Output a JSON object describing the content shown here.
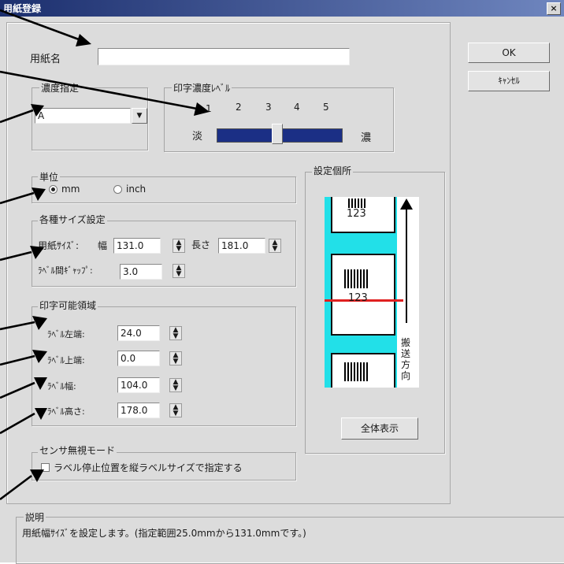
{
  "window": {
    "title": "用紙登録",
    "close": "×"
  },
  "paper_name": {
    "label": "用紙名",
    "value": ""
  },
  "density": {
    "group_label": "濃度指定",
    "value": "A"
  },
  "print_level": {
    "group_label": "印字濃度ﾚﾍﾞﾙ",
    "ticks": [
      "1",
      "2",
      "3",
      "4",
      "5"
    ],
    "low_label": "淡",
    "high_label": "濃",
    "level": 3
  },
  "unit": {
    "group_label": "単位",
    "options": [
      "mm",
      "inch"
    ],
    "selected": "mm"
  },
  "size": {
    "group_label": "各種サイズ設定",
    "paper_size_label": "用紙ｻｲｽﾞ:",
    "width_label": "幅",
    "width_value": "131.0",
    "length_label": "長さ",
    "length_value": "181.0",
    "gap_label": "ﾗﾍﾞﾙ間ｷﾞｬｯﾌﾟ:",
    "gap_value": "3.0"
  },
  "print_area": {
    "group_label": "印字可能領域",
    "rows": [
      {
        "label": "ﾗﾍﾞﾙ左端:",
        "value": "24.0"
      },
      {
        "label": "ﾗﾍﾞﾙ上端:",
        "value": "0.0"
      },
      {
        "label": "ﾗﾍﾞﾙ幅:",
        "value": "104.0"
      },
      {
        "label": "ﾗﾍﾞﾙ高さ:",
        "value": "178.0"
      }
    ]
  },
  "sensor_mode": {
    "group_label": "センサ無視モード",
    "checkbox_label": "ラベル停止位置を縦ラベルサイズで指定する"
  },
  "setting_area": {
    "group_label": "設定個所",
    "barcode_text": [
      "123",
      "123"
    ],
    "direction_chars": [
      "搬",
      "送",
      "方",
      "向"
    ],
    "show_all_button": "全体表示",
    "colors": {
      "paper": "#22e0e8",
      "guide": "#e02020",
      "label_bg": "#ffffff"
    }
  },
  "buttons": {
    "ok": "OK",
    "cancel": "ｷｬﾝｾﾙ"
  },
  "description": {
    "label": "説明",
    "text": "用紙幅ｻｲｽﾞを設定します。(指定範囲25.0mmから131.0mmです。)"
  }
}
